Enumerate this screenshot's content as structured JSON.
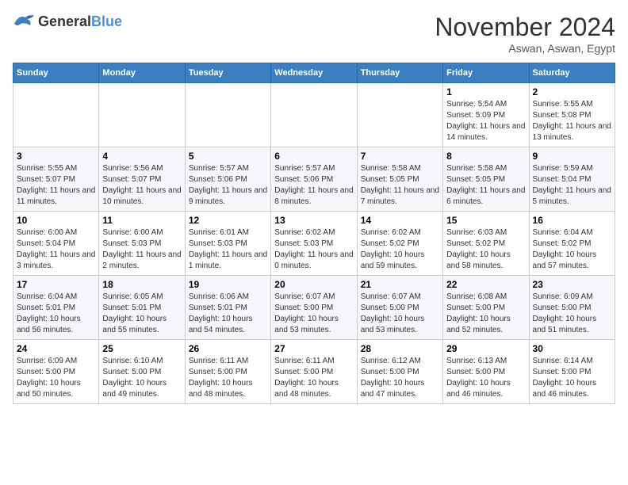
{
  "logo": {
    "text1": "General",
    "text2": "Blue"
  },
  "header": {
    "month": "November 2024",
    "location": "Aswan, Aswan, Egypt"
  },
  "weekdays": [
    "Sunday",
    "Monday",
    "Tuesday",
    "Wednesday",
    "Thursday",
    "Friday",
    "Saturday"
  ],
  "weeks": [
    [
      {
        "day": "",
        "info": ""
      },
      {
        "day": "",
        "info": ""
      },
      {
        "day": "",
        "info": ""
      },
      {
        "day": "",
        "info": ""
      },
      {
        "day": "",
        "info": ""
      },
      {
        "day": "1",
        "info": "Sunrise: 5:54 AM\nSunset: 5:09 PM\nDaylight: 11 hours and 14 minutes."
      },
      {
        "day": "2",
        "info": "Sunrise: 5:55 AM\nSunset: 5:08 PM\nDaylight: 11 hours and 13 minutes."
      }
    ],
    [
      {
        "day": "3",
        "info": "Sunrise: 5:55 AM\nSunset: 5:07 PM\nDaylight: 11 hours and 11 minutes."
      },
      {
        "day": "4",
        "info": "Sunrise: 5:56 AM\nSunset: 5:07 PM\nDaylight: 11 hours and 10 minutes."
      },
      {
        "day": "5",
        "info": "Sunrise: 5:57 AM\nSunset: 5:06 PM\nDaylight: 11 hours and 9 minutes."
      },
      {
        "day": "6",
        "info": "Sunrise: 5:57 AM\nSunset: 5:06 PM\nDaylight: 11 hours and 8 minutes."
      },
      {
        "day": "7",
        "info": "Sunrise: 5:58 AM\nSunset: 5:05 PM\nDaylight: 11 hours and 7 minutes."
      },
      {
        "day": "8",
        "info": "Sunrise: 5:58 AM\nSunset: 5:05 PM\nDaylight: 11 hours and 6 minutes."
      },
      {
        "day": "9",
        "info": "Sunrise: 5:59 AM\nSunset: 5:04 PM\nDaylight: 11 hours and 5 minutes."
      }
    ],
    [
      {
        "day": "10",
        "info": "Sunrise: 6:00 AM\nSunset: 5:04 PM\nDaylight: 11 hours and 3 minutes."
      },
      {
        "day": "11",
        "info": "Sunrise: 6:00 AM\nSunset: 5:03 PM\nDaylight: 11 hours and 2 minutes."
      },
      {
        "day": "12",
        "info": "Sunrise: 6:01 AM\nSunset: 5:03 PM\nDaylight: 11 hours and 1 minute."
      },
      {
        "day": "13",
        "info": "Sunrise: 6:02 AM\nSunset: 5:03 PM\nDaylight: 11 hours and 0 minutes."
      },
      {
        "day": "14",
        "info": "Sunrise: 6:02 AM\nSunset: 5:02 PM\nDaylight: 10 hours and 59 minutes."
      },
      {
        "day": "15",
        "info": "Sunrise: 6:03 AM\nSunset: 5:02 PM\nDaylight: 10 hours and 58 minutes."
      },
      {
        "day": "16",
        "info": "Sunrise: 6:04 AM\nSunset: 5:02 PM\nDaylight: 10 hours and 57 minutes."
      }
    ],
    [
      {
        "day": "17",
        "info": "Sunrise: 6:04 AM\nSunset: 5:01 PM\nDaylight: 10 hours and 56 minutes."
      },
      {
        "day": "18",
        "info": "Sunrise: 6:05 AM\nSunset: 5:01 PM\nDaylight: 10 hours and 55 minutes."
      },
      {
        "day": "19",
        "info": "Sunrise: 6:06 AM\nSunset: 5:01 PM\nDaylight: 10 hours and 54 minutes."
      },
      {
        "day": "20",
        "info": "Sunrise: 6:07 AM\nSunset: 5:00 PM\nDaylight: 10 hours and 53 minutes."
      },
      {
        "day": "21",
        "info": "Sunrise: 6:07 AM\nSunset: 5:00 PM\nDaylight: 10 hours and 53 minutes."
      },
      {
        "day": "22",
        "info": "Sunrise: 6:08 AM\nSunset: 5:00 PM\nDaylight: 10 hours and 52 minutes."
      },
      {
        "day": "23",
        "info": "Sunrise: 6:09 AM\nSunset: 5:00 PM\nDaylight: 10 hours and 51 minutes."
      }
    ],
    [
      {
        "day": "24",
        "info": "Sunrise: 6:09 AM\nSunset: 5:00 PM\nDaylight: 10 hours and 50 minutes."
      },
      {
        "day": "25",
        "info": "Sunrise: 6:10 AM\nSunset: 5:00 PM\nDaylight: 10 hours and 49 minutes."
      },
      {
        "day": "26",
        "info": "Sunrise: 6:11 AM\nSunset: 5:00 PM\nDaylight: 10 hours and 48 minutes."
      },
      {
        "day": "27",
        "info": "Sunrise: 6:11 AM\nSunset: 5:00 PM\nDaylight: 10 hours and 48 minutes."
      },
      {
        "day": "28",
        "info": "Sunrise: 6:12 AM\nSunset: 5:00 PM\nDaylight: 10 hours and 47 minutes."
      },
      {
        "day": "29",
        "info": "Sunrise: 6:13 AM\nSunset: 5:00 PM\nDaylight: 10 hours and 46 minutes."
      },
      {
        "day": "30",
        "info": "Sunrise: 6:14 AM\nSunset: 5:00 PM\nDaylight: 10 hours and 46 minutes."
      }
    ]
  ]
}
